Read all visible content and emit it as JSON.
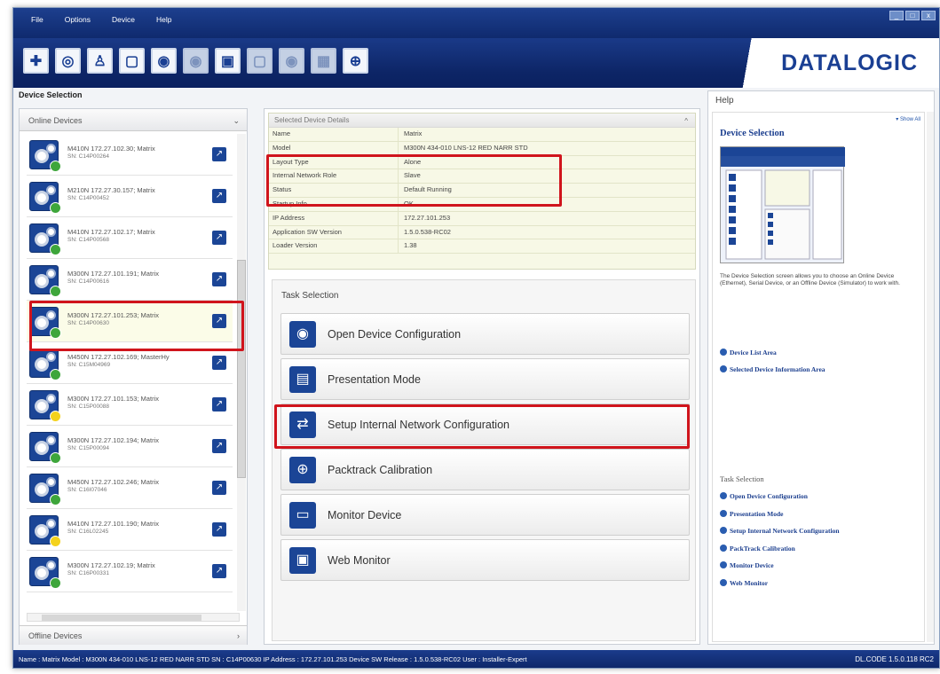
{
  "menu": [
    "File",
    "Options",
    "Device",
    "Help"
  ],
  "window_controls": [
    "_",
    "□",
    "x"
  ],
  "brand": "DATALOGIC",
  "device_selection_title": "Device Selection",
  "online_devices_label": "Online Devices",
  "offline_devices_label": "Offline Devices",
  "devices": [
    {
      "name": "M410N 172.27.102.30; Matrix",
      "sn": "SN: C14P00264",
      "status": "green"
    },
    {
      "name": "M210N 172.27.30.157; Matrix",
      "sn": "SN: C14P00452",
      "status": "green"
    },
    {
      "name": "M410N 172.27.102.17; Matrix",
      "sn": "SN: C14P00568",
      "status": "green"
    },
    {
      "name": "M300N 172.27.101.191; Matrix",
      "sn": "SN: C14P00616",
      "status": "green"
    },
    {
      "name": "M300N 172.27.101.253; Matrix",
      "sn": "SN: C14P00630",
      "status": "green"
    },
    {
      "name": "M450N 172.27.102.169; MasterHy",
      "sn": "SN: C15M04969",
      "status": "green"
    },
    {
      "name": "M300N 172.27.101.153; Matrix",
      "sn": "SN: C15P00088",
      "status": "yellow"
    },
    {
      "name": "M300N 172.27.102.194; Matrix",
      "sn": "SN: C15P00094",
      "status": "green"
    },
    {
      "name": "M450N 172.27.102.246; Matrix",
      "sn": "SN: C16I07046",
      "status": "green"
    },
    {
      "name": "M410N 172.27.101.190; Matrix",
      "sn": "SN: C16L02245",
      "status": "yellow"
    },
    {
      "name": "M300N 172.27.102.19; Matrix",
      "sn": "SN: C16P00331",
      "status": "green"
    }
  ],
  "selected_details_title": "Selected Device Details",
  "details": [
    {
      "k": "Name",
      "v": "Matrix"
    },
    {
      "k": "Model",
      "v": "M300N 434-010 LNS-12 RED NARR STD"
    },
    {
      "k": "Layout Type",
      "v": "Alone"
    },
    {
      "k": "Internal Network Role",
      "v": "Slave"
    },
    {
      "k": "Status",
      "v": "Default Running"
    },
    {
      "k": "Startup Info",
      "v": "OK"
    },
    {
      "k": "IP Address",
      "v": "172.27.101.253"
    },
    {
      "k": "Application SW Version",
      "v": "1.5.0.538-RC02"
    },
    {
      "k": "Loader Version",
      "v": "1.38"
    }
  ],
  "task_selection_title": "Task Selection",
  "tasks": [
    {
      "label": "Open Device Configuration",
      "icon": "open-config-icon"
    },
    {
      "label": "Presentation Mode",
      "icon": "presentation-icon"
    },
    {
      "label": "Setup Internal Network Configuration",
      "icon": "network-icon"
    },
    {
      "label": "Packtrack Calibration",
      "icon": "crosshair-icon"
    },
    {
      "label": "Monitor Device",
      "icon": "monitor-icon"
    },
    {
      "label": "Web Monitor",
      "icon": "web-monitor-icon"
    }
  ],
  "help": {
    "title": "Help",
    "show_all": "▾ Show All",
    "heading": "Device Selection",
    "description": "The Device Selection screen allows you to choose an Online Device (Ethernet), Serial Device, or an Offline Device (Simulator) to work with.",
    "links_top": [
      "Device List Area",
      "Selected Device Information Area"
    ],
    "task_heading": "Task Selection",
    "task_links": [
      "Open Device Configuration",
      "Presentation Mode",
      "Setup Internal Network Configuration",
      "PackTrack Calibration",
      "Monitor Device",
      "Web Monitor"
    ]
  },
  "statusbar": {
    "text": "Name : Matrix   Model : M300N 434-010 LNS-12 RED NARR STD   SN : C14P00630   IP Address :  172.27.101.253   Device SW Release : 1.5.0.538-RC02   User : Installer-Expert",
    "version": "DL.CODE 1.5.0.118 RC2"
  },
  "colors": {
    "accent": "#1b4596",
    "highlight": "#d0141c",
    "panel": "#f7f8e6"
  }
}
